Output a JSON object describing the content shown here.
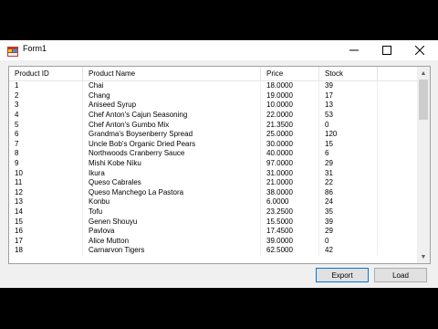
{
  "window": {
    "title": "Form1"
  },
  "grid": {
    "columns": [
      "Product ID",
      "Product Name",
      "Price",
      "Stock"
    ],
    "rows": [
      [
        "1",
        "Chai",
        "18.0000",
        "39"
      ],
      [
        "2",
        "Chang",
        "19.0000",
        "17"
      ],
      [
        "3",
        "Aniseed Syrup",
        "10.0000",
        "13"
      ],
      [
        "4",
        "Chef Anton's Cajun Seasoning",
        "22.0000",
        "53"
      ],
      [
        "5",
        "Chef Anton's Gumbo Mix",
        "21.3500",
        "0"
      ],
      [
        "6",
        "Grandma's Boysenberry Spread",
        "25.0000",
        "120"
      ],
      [
        "7",
        "Uncle Bob's Organic Dried Pears",
        "30.0000",
        "15"
      ],
      [
        "8",
        "Northwoods Cranberry Sauce",
        "40.0000",
        "6"
      ],
      [
        "9",
        "Mishi Kobe Niku",
        "97.0000",
        "29"
      ],
      [
        "10",
        "Ikura",
        "31.0000",
        "31"
      ],
      [
        "11",
        "Queso Cabrales",
        "21.0000",
        "22"
      ],
      [
        "12",
        "Queso Manchego La Pastora",
        "38.0000",
        "86"
      ],
      [
        "13",
        "Konbu",
        "6.0000",
        "24"
      ],
      [
        "14",
        "Tofu",
        "23.2500",
        "35"
      ],
      [
        "15",
        "Genen Shouyu",
        "15.5000",
        "39"
      ],
      [
        "16",
        "Pavlova",
        "17.4500",
        "29"
      ],
      [
        "17",
        "Alice Mutton",
        "39.0000",
        "0"
      ],
      [
        "18",
        "Carnarvon Tigers",
        "62.5000",
        "42"
      ]
    ]
  },
  "buttons": {
    "export": "Export",
    "load": "Load"
  }
}
